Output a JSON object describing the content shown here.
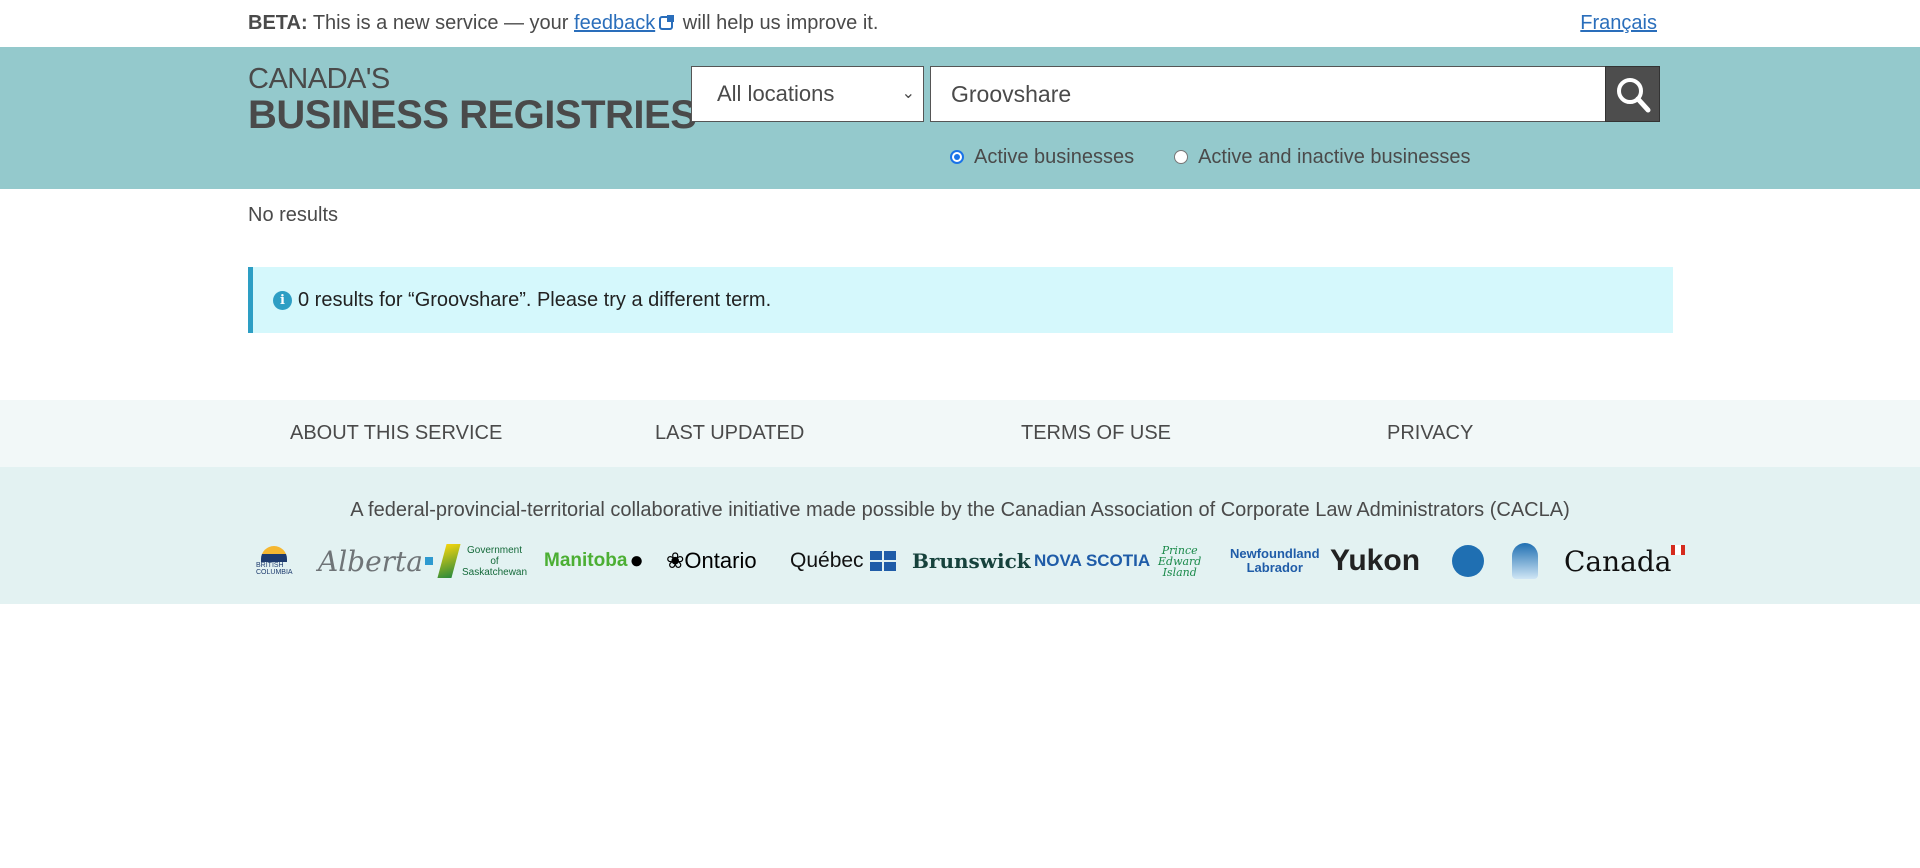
{
  "banner": {
    "beta_label": "BETA:",
    "text_before": " This is a new service — your ",
    "link": "feedback",
    "text_after": " will help us improve it.",
    "language_link": "Français"
  },
  "header": {
    "logo_line1": "CANADA'S",
    "logo_line2": "BUSINESS REGISTRIES",
    "location_select": "All locations",
    "search_value": "Groovshare",
    "search_icon": "magnifier-icon",
    "radios": [
      {
        "label": "Active businesses",
        "checked": true
      },
      {
        "label": "Active and inactive businesses",
        "checked": false
      }
    ]
  },
  "main": {
    "status": "No results",
    "alert": "0 results for “Groovshare”. Please try a different term.",
    "alert_color": "#d5f8fc"
  },
  "footer": {
    "links": [
      "ABOUT THIS SERVICE",
      "LAST UPDATED",
      "TERMS OF USE",
      "PRIVACY"
    ],
    "initiative": "A federal-provincial-territorial collaborative initiative made possible by the Canadian Association of Corporate Law Administrators (CACLA)",
    "logos": [
      "British Columbia",
      "Alberta",
      "Government of Saskatchewan",
      "Manitoba",
      "Ontario",
      "Québec",
      "New Brunswick Nouveau",
      "Nova Scotia",
      "Prince Edward Island",
      "Newfoundland Labrador",
      "Yukon",
      "Northwest Territories",
      "Nunavut",
      "Canada"
    ]
  }
}
